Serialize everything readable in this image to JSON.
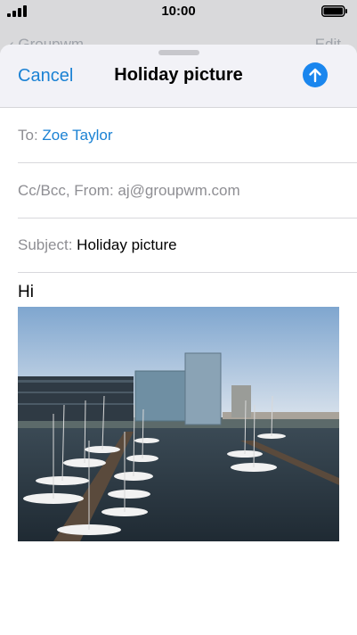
{
  "status": {
    "time": "10:00"
  },
  "background": {
    "back_label": "Groupwm",
    "edit_label": "Edit"
  },
  "compose": {
    "cancel_label": "Cancel",
    "title": "Holiday picture",
    "to_label": "To:",
    "to_value": "Zoe Taylor",
    "cc_label": "Cc/Bcc, From:",
    "cc_value": "aj@groupwm.com",
    "subject_label": "Subject:",
    "subject_value": "Holiday picture",
    "body_text": "Hi"
  },
  "colors": {
    "accent": "#1b82d4",
    "send_button": "#1a86ee",
    "header_bg": "#f2f2f7",
    "placeholder": "#8e8e93"
  },
  "icons": {
    "send": "arrow-up-circle-icon",
    "signal": "signal-icon",
    "battery": "battery-icon"
  }
}
